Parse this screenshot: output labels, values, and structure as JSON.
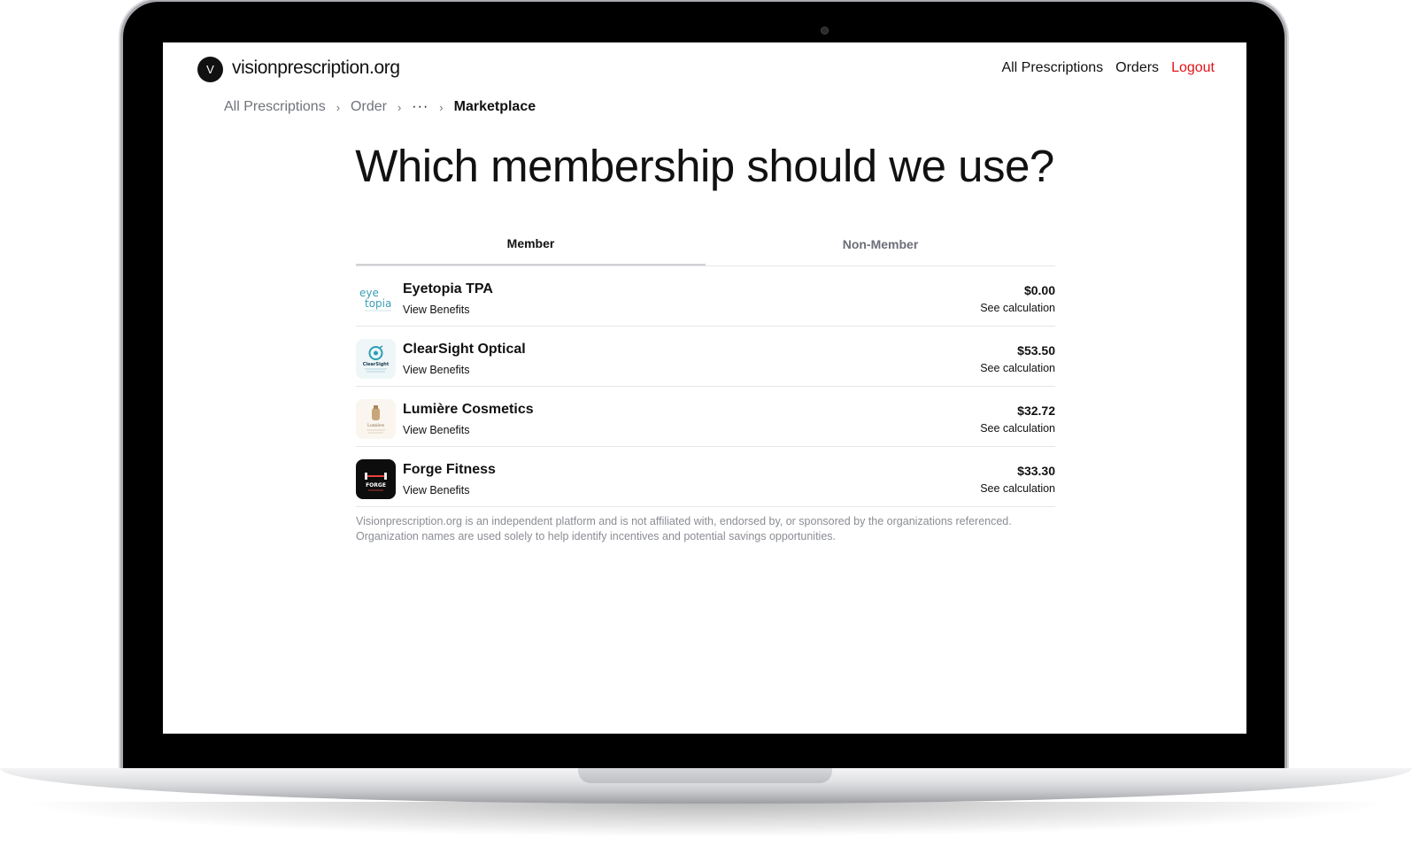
{
  "site": {
    "logo_letter": "V",
    "name": "visionprescription.org"
  },
  "nav": {
    "all_prescriptions": "All Prescriptions",
    "orders": "Orders",
    "logout": "Logout"
  },
  "breadcrumb": {
    "items": [
      "All Prescriptions",
      "Order",
      "···"
    ],
    "current": "Marketplace",
    "separator": "›"
  },
  "heading": "Which membership should we use?",
  "tabs": [
    {
      "label": "Member",
      "active": true
    },
    {
      "label": "Non-Member",
      "active": false
    }
  ],
  "memberships": [
    {
      "name": "Eyetopia TPA",
      "benefits_link": "View Benefits",
      "price": "$0.00",
      "calc_link": "See calculation",
      "logo_icon": "eyetopia-logo",
      "logo_text": "eye topia"
    },
    {
      "name": "ClearSight Optical",
      "benefits_link": "View Benefits",
      "price": "$53.50",
      "calc_link": "See calculation",
      "logo_icon": "clearsight-logo",
      "logo_text": "ClearSight"
    },
    {
      "name": "Lumière Cosmetics",
      "benefits_link": "View Benefits",
      "price": "$32.72",
      "calc_link": "See calculation",
      "logo_icon": "lumiere-logo",
      "logo_text": "Lumière"
    },
    {
      "name": "Forge Fitness",
      "benefits_link": "View Benefits",
      "price": "$33.30",
      "calc_link": "See calculation",
      "logo_icon": "forge-logo",
      "logo_text": "FORGE"
    }
  ],
  "disclaimer": {
    "line1": "Visionprescription.org is an independent platform and is not affiliated with, endorsed by, or sponsored by the organizations referenced.",
    "line2": "Organization names are used solely to help identify incentives and potential savings opportunities."
  },
  "colors": {
    "logout": "#e0141a",
    "text": "#111111",
    "muted": "#70737a"
  }
}
